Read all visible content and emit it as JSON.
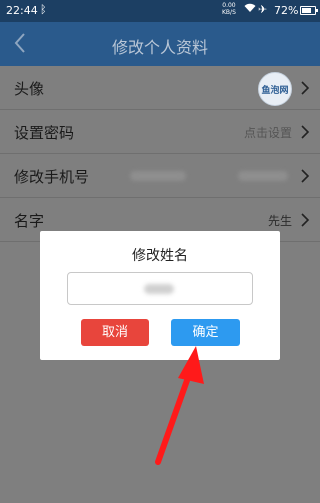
{
  "status_bar": {
    "time": "22:44",
    "network_speed_value": "0.00",
    "network_speed_unit": "KB/S",
    "battery_percent_text": "72%",
    "battery_level": 0.72,
    "icons": [
      "bluetooth-icon",
      "wifi-icon",
      "airplane-icon",
      "battery-icon"
    ]
  },
  "header": {
    "title": "修改个人资料",
    "back_icon": "chevron-left-icon"
  },
  "list": {
    "items": [
      {
        "label": "头像",
        "value": "鱼泡网"
      },
      {
        "label": "设置密码",
        "value": "点击设置"
      },
      {
        "label": "修改手机号",
        "value": ""
      },
      {
        "label": "名字",
        "value": "先生"
      }
    ]
  },
  "dialog": {
    "title": "修改姓名",
    "input_value": "",
    "cancel_label": "取消",
    "confirm_label": "确定"
  },
  "colors": {
    "status_bar": "#1c3f63",
    "nav_bar": "#2a5a8c",
    "cancel": "#e8453c",
    "confirm": "#2d9af0",
    "annotation_arrow": "#ff1a1a"
  }
}
